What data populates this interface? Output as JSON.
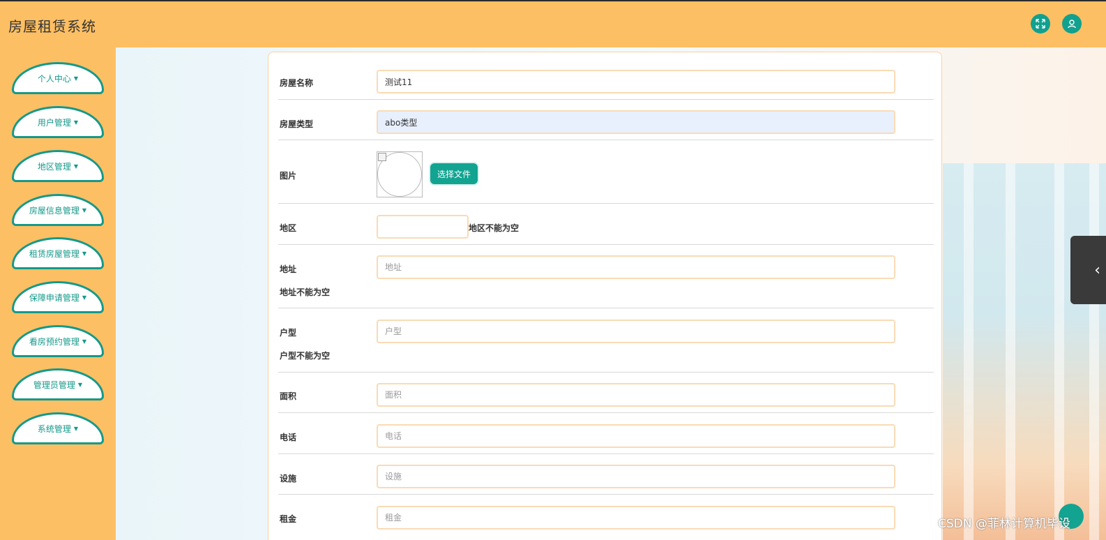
{
  "header": {
    "title": "房屋租赁系统",
    "fullscreen_icon": "expand-icon",
    "user_icon": "user-icon"
  },
  "sidebar": {
    "items": [
      {
        "label": "个人中心"
      },
      {
        "label": "用户管理"
      },
      {
        "label": "地区管理"
      },
      {
        "label": "房屋信息管理"
      },
      {
        "label": "租赁房屋管理"
      },
      {
        "label": "保障申请管理"
      },
      {
        "label": "看房预约管理"
      },
      {
        "label": "管理员管理"
      },
      {
        "label": "系统管理"
      }
    ]
  },
  "form": {
    "house_name": {
      "label": "房屋名称",
      "value": "测试11"
    },
    "house_type": {
      "label": "房屋类型",
      "value": "abo类型"
    },
    "picture": {
      "label": "图片",
      "button": "选择文件"
    },
    "region": {
      "label": "地区",
      "error": "地区不能为空"
    },
    "address": {
      "label": "地址",
      "placeholder": "地址",
      "error": "地址不能为空"
    },
    "layout": {
      "label": "户型",
      "placeholder": "户型",
      "error": "户型不能为空"
    },
    "area": {
      "label": "面积",
      "placeholder": "面积"
    },
    "phone": {
      "label": "电话",
      "placeholder": "电话"
    },
    "facilities": {
      "label": "设施",
      "placeholder": "设施"
    },
    "rent": {
      "label": "租金",
      "placeholder": "租金"
    }
  },
  "watermark": "CSDN @菲林计算机毕设",
  "colors": {
    "header": "#fdbf63",
    "accent": "#15998a",
    "button": "#13a391"
  }
}
